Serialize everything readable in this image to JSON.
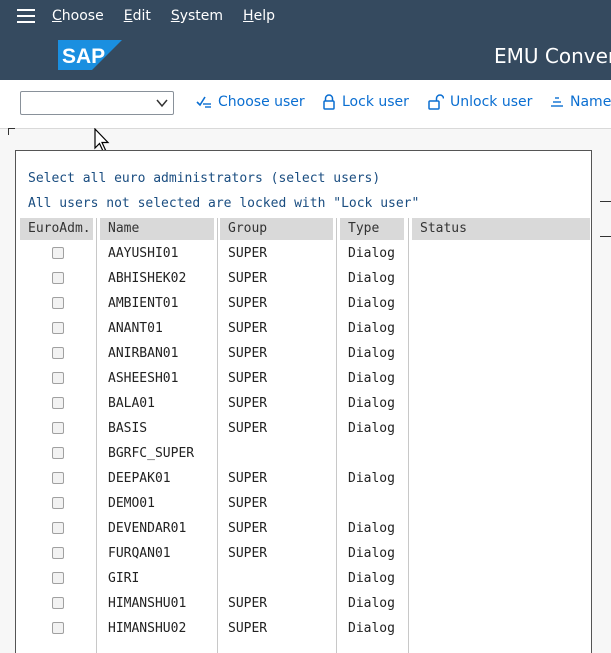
{
  "menubar": {
    "items": [
      "Choose",
      "Edit",
      "System",
      "Help"
    ]
  },
  "titlebar": {
    "logo_text": "SAP",
    "title": "EMU Conver"
  },
  "toolbar": {
    "command_field_value": "",
    "buttons": {
      "choose_user": "Choose user",
      "lock_user": "Lock user",
      "unlock_user": "Unlock user",
      "name": "Name"
    }
  },
  "content": {
    "line1": "Select all euro administrators (select users)",
    "line2": "All users not selected are locked with \"Lock user\"",
    "columns": [
      "EuroAdm.",
      "Name",
      "Group",
      "Type",
      "Status"
    ],
    "rows": [
      {
        "name": "AAYUSHI01",
        "group": "SUPER",
        "type": "Dialog",
        "status": ""
      },
      {
        "name": "ABHISHEK02",
        "group": "SUPER",
        "type": "Dialog",
        "status": ""
      },
      {
        "name": "AMBIENT01",
        "group": "SUPER",
        "type": "Dialog",
        "status": ""
      },
      {
        "name": "ANANT01",
        "group": "SUPER",
        "type": "Dialog",
        "status": ""
      },
      {
        "name": "ANIRBAN01",
        "group": "SUPER",
        "type": "Dialog",
        "status": ""
      },
      {
        "name": "ASHEESH01",
        "group": "SUPER",
        "type": "Dialog",
        "status": ""
      },
      {
        "name": "BALA01",
        "group": "SUPER",
        "type": "Dialog",
        "status": ""
      },
      {
        "name": "BASIS",
        "group": "SUPER",
        "type": "Dialog",
        "status": ""
      },
      {
        "name": "BGRFC_SUPER",
        "group": "",
        "type": "",
        "status": ""
      },
      {
        "name": "DEEPAK01",
        "group": "SUPER",
        "type": "Dialog",
        "status": ""
      },
      {
        "name": "DEMO01",
        "group": "SUPER",
        "type": "",
        "status": ""
      },
      {
        "name": "DEVENDAR01",
        "group": "SUPER",
        "type": "Dialog",
        "status": ""
      },
      {
        "name": "FURQAN01",
        "group": "SUPER",
        "type": "Dialog",
        "status": ""
      },
      {
        "name": "GIRI",
        "group": "",
        "type": "Dialog",
        "status": ""
      },
      {
        "name": "HIMANSHU01",
        "group": "SUPER",
        "type": "Dialog",
        "status": ""
      },
      {
        "name": "HIMANSHU02",
        "group": "SUPER",
        "type": "Dialog",
        "status": ""
      }
    ]
  },
  "colors": {
    "shell": "#354a5f",
    "link": "#0a6ed1",
    "info_text": "#1a4d80",
    "header_bg": "#d9d9d9"
  }
}
